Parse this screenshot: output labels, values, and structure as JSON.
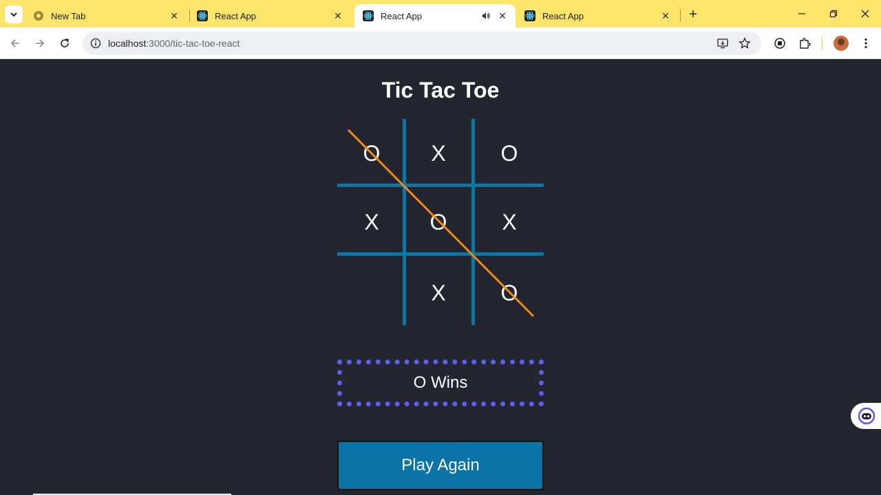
{
  "browser": {
    "tabs": [
      {
        "title": "New Tab",
        "icon": "chrome-icon",
        "active": false
      },
      {
        "title": "React App",
        "icon": "react-icon",
        "active": false
      },
      {
        "title": "React App",
        "icon": "react-icon",
        "active": true,
        "audio": true
      },
      {
        "title": "React App",
        "icon": "react-icon",
        "active": false
      }
    ],
    "url_host": "localhost",
    "url_path": ":3000/tic-tac-toe-react"
  },
  "game": {
    "title": "Tic Tac Toe",
    "cells": [
      "O",
      "X",
      "O",
      "X",
      "O",
      "X",
      "",
      "X",
      "O"
    ],
    "winning_line": "diagonal-top-left-to-bottom-right",
    "status": "O Wins",
    "play_again_label": "Play Again"
  },
  "colors": {
    "tab_strip": "#fde46b",
    "page_bg": "#23252f",
    "grid": "#0a77a7",
    "strike": "#f08a16",
    "status_border": "#5b5ff2",
    "button_bg": "#0a73a8"
  }
}
